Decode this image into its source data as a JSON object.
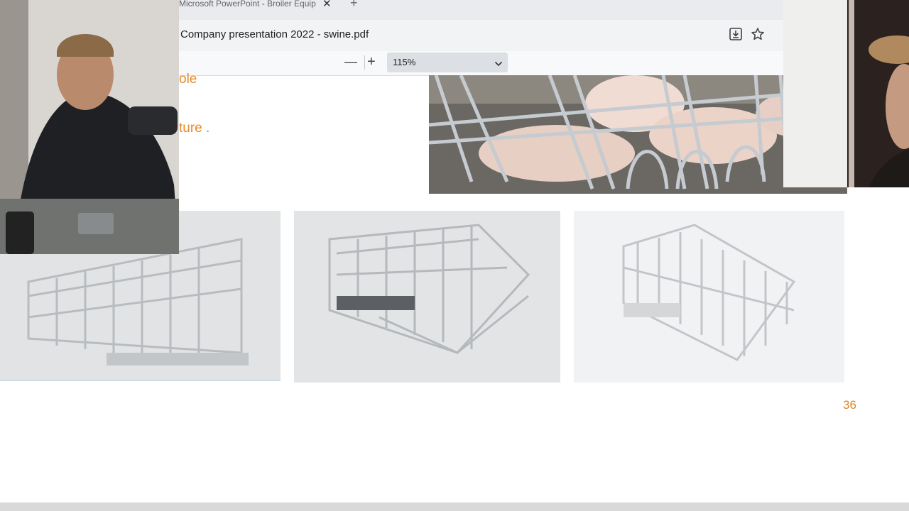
{
  "browser": {
    "tab_title": "Microsoft PowerPoint - Broiler Equip",
    "tab_close_glyph": "✕",
    "new_tab_glyph": "+",
    "doc_title": "Company presentation 2022 - swine.pdf",
    "download_icon": "download-icon",
    "bookmark_icon": "star-icon"
  },
  "pdf_toolbar": {
    "zoom_out_glyph": "—",
    "zoom_in_glyph": "+",
    "zoom_value": "115%",
    "zoom_dropdown_icon": "chevron-down-icon"
  },
  "slide": {
    "text_fragment_1": "ole",
    "text_fragment_2": "ture .",
    "page_number": "36",
    "accent_color": "#e38a2f",
    "images": [
      "pig-pens-photo",
      "farrowing-crate-render-left",
      "farrowing-crate-render-center",
      "farrowing-crate-render-right"
    ]
  },
  "webcam_overlays": [
    "presenter-webcam-left",
    "presenter-webcam-right"
  ]
}
